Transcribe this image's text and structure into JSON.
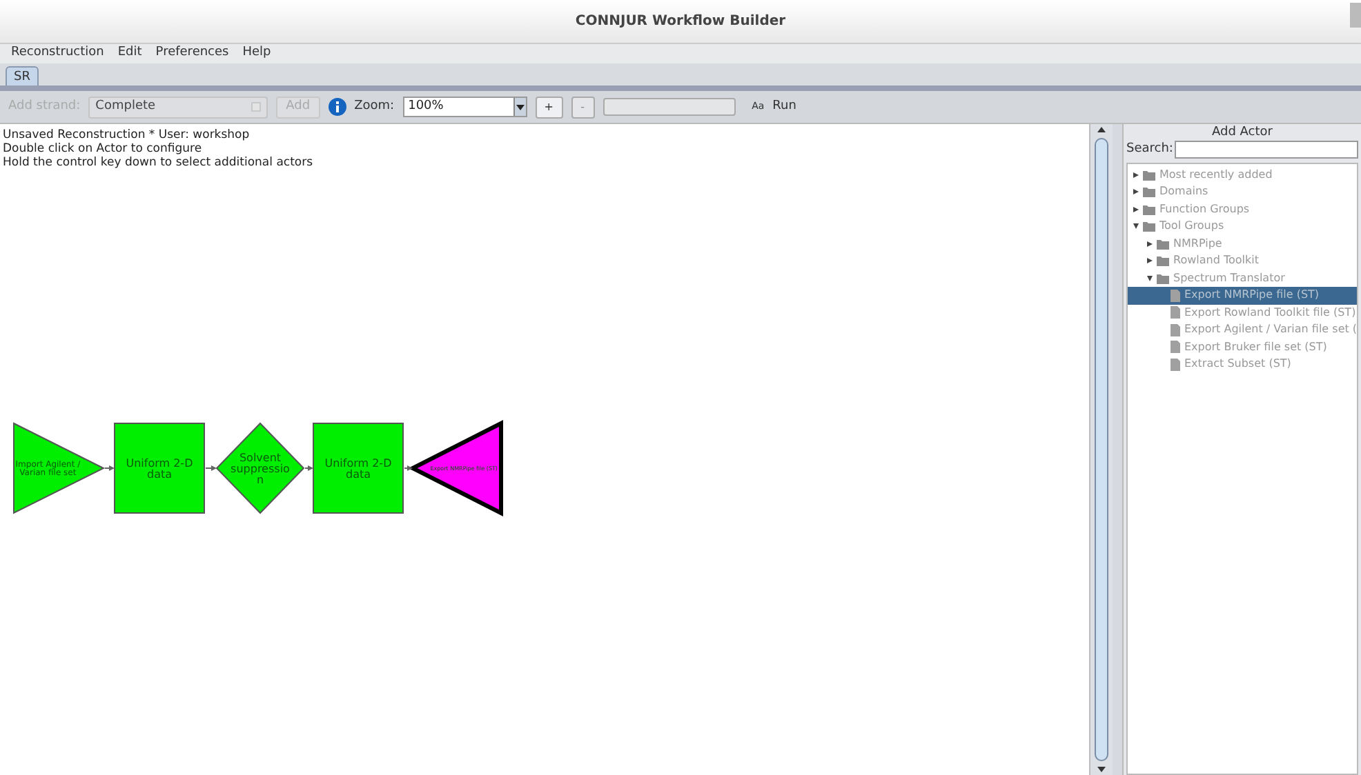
{
  "window": {
    "title": "CONNJUR Workflow Builder"
  },
  "menu": [
    "Reconstruction",
    "Edit",
    "Preferences",
    "Help"
  ],
  "tabs": [
    {
      "label": "SR",
      "selected": true
    }
  ],
  "toolbar": {
    "strand_label": "Add strand:",
    "strand_value": "Complete",
    "add_button": "Add",
    "zoom_label": "Zoom:",
    "zoom_value": "100%",
    "zoom_in": "+",
    "zoom_out": "-",
    "progress": {
      "level": 0
    },
    "font_glyph": "Aa",
    "run": "Run"
  },
  "canvas": {
    "info_lines": [
      "Unsaved Reconstruction * User: workshop",
      "Double click on Actor to configure",
      "Hold the control key down to select additional actors"
    ],
    "nodes": [
      {
        "kind": "triangle-right",
        "color": "#00ee00",
        "selected": false,
        "lines": [
          "Import Agilent /",
          "Varian file set"
        ]
      },
      {
        "kind": "square",
        "color": "#00ee00",
        "selected": false,
        "lines": [
          "Uniform 2-D",
          "data"
        ]
      },
      {
        "kind": "diamond",
        "color": "#00ee00",
        "selected": false,
        "lines": [
          "Solvent",
          "suppressio",
          "n"
        ]
      },
      {
        "kind": "square",
        "color": "#00ee00",
        "selected": false,
        "lines": [
          "Uniform 2-D",
          "data"
        ]
      },
      {
        "kind": "triangle-left",
        "color": "#ff00ff",
        "selected": true,
        "lines": [
          "Export NMRPipe file (ST)"
        ]
      }
    ]
  },
  "add_actor": {
    "title": "Add Actor",
    "search_label": "Search:",
    "tree": [
      {
        "label": "Most recently added",
        "kind": "folder",
        "expanded": false,
        "selected": false
      },
      {
        "label": "Domains",
        "kind": "folder",
        "expanded": false,
        "selected": false
      },
      {
        "label": "Function Groups",
        "kind": "folder",
        "expanded": false,
        "selected": false
      },
      {
        "label": "Tool Groups",
        "kind": "folder",
        "expanded": true,
        "selected": false,
        "children": [
          {
            "label": "NMRPipe",
            "kind": "folder",
            "expanded": false,
            "selected": false
          },
          {
            "label": "Rowland Toolkit",
            "kind": "folder",
            "expanded": false,
            "selected": false
          },
          {
            "label": "Spectrum Translator",
            "kind": "folder",
            "expanded": true,
            "selected": false,
            "children": [
              {
                "label": "Export NMRPipe file (ST)",
                "kind": "file",
                "selected": true
              },
              {
                "label": "Export Rowland Toolkit file (ST)",
                "kind": "file",
                "selected": false
              },
              {
                "label": "Export Agilent / Varian file set (",
                "kind": "file",
                "selected": false
              },
              {
                "label": "Export Bruker file set (ST)",
                "kind": "file",
                "selected": false
              },
              {
                "label": "Extract Subset (ST)",
                "kind": "file",
                "selected": false
              }
            ]
          }
        ]
      }
    ]
  }
}
